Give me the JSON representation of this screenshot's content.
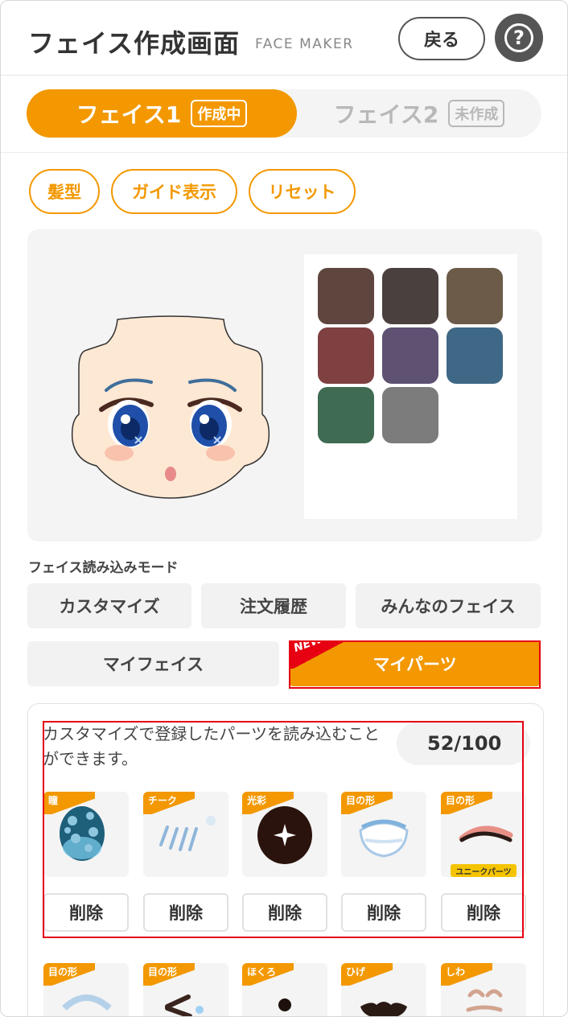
{
  "header": {
    "title": "フェイス作成画面",
    "subtitle": "FACE MAKER",
    "back_label": "戻る",
    "help_label": "?"
  },
  "face_tabs": [
    {
      "label": "フェイス1",
      "badge": "作成中",
      "active": true
    },
    {
      "label": "フェイス2",
      "badge": "未作成",
      "active": false
    }
  ],
  "tools": {
    "hair": "髪型",
    "guide": "ガイド表示",
    "reset": "リセット"
  },
  "palette": [
    "#5e463e",
    "#4a403e",
    "#6b5b48",
    "#7f4042",
    "#5e5172",
    "#3e6886",
    "#3f6b52",
    "#7c7c7c"
  ],
  "mode": {
    "label": "フェイス読み込みモード",
    "buttons": [
      "カスタマイズ",
      "注文履歴",
      "みんなのフェイス",
      "マイフェイス",
      "マイパーツ"
    ],
    "active": "マイパーツ",
    "new_badge": "NEW!"
  },
  "my_parts": {
    "description": "カスタマイズで登録したパーツを読み込むことができます。",
    "count": "52/100",
    "delete_label": "削除",
    "unique_label": "ユニークパーツ",
    "row1": [
      "瞳",
      "チーク",
      "光彩",
      "目の形",
      "目の形"
    ],
    "row2": [
      "目の形",
      "目の形",
      "ほくろ",
      "ひげ",
      "しわ"
    ]
  },
  "colors": {
    "accent": "#f39800",
    "highlight": "#e60012"
  }
}
